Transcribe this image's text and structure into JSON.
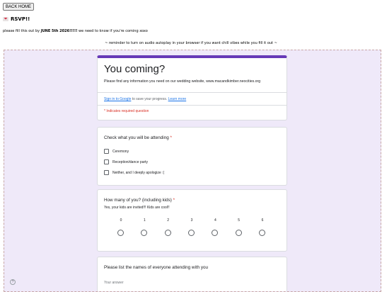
{
  "page": {
    "back_button": "BACK HOME",
    "heart_icon_glyph": "❤",
    "title": "RSVP!!",
    "intro_before": "please fill this out by ",
    "intro_bold": "JUNE 5th 2026!!!!!",
    "intro_after": " we need to know if you're coming xoxo",
    "reminder": "~ reminder to turn on audio autoplay in your browser if you want chill vibes while you fill it out ~"
  },
  "form": {
    "accent_color": "#673ab7",
    "background_color": "#efe9f9",
    "title": "You coming?",
    "description": "Please find any information you need on our wedding website, www.macandkimber.neocities.org",
    "sign_in_link": "Sign in to Google",
    "sign_in_text": " to save your progress. ",
    "learn_more_link": "Learn more",
    "required_note": "* Indicates required question",
    "q1": {
      "title": "Check what you will be attending",
      "required_mark": "*",
      "options": [
        "Ceremony",
        "Reception/dance party",
        "Neither, and I deeply apologize :("
      ]
    },
    "q2": {
      "title": "How many of you? (including kids)",
      "required_mark": "*",
      "subtitle": "Yes, your kids are invited!!! Kids are cool!!",
      "scale": [
        "0",
        "1",
        "2",
        "3",
        "4",
        "5",
        "6"
      ]
    },
    "q3": {
      "title": "Please list the names of everyone attending with you",
      "answer_placeholder": "Your answer"
    },
    "help_icon_glyph": "?"
  }
}
